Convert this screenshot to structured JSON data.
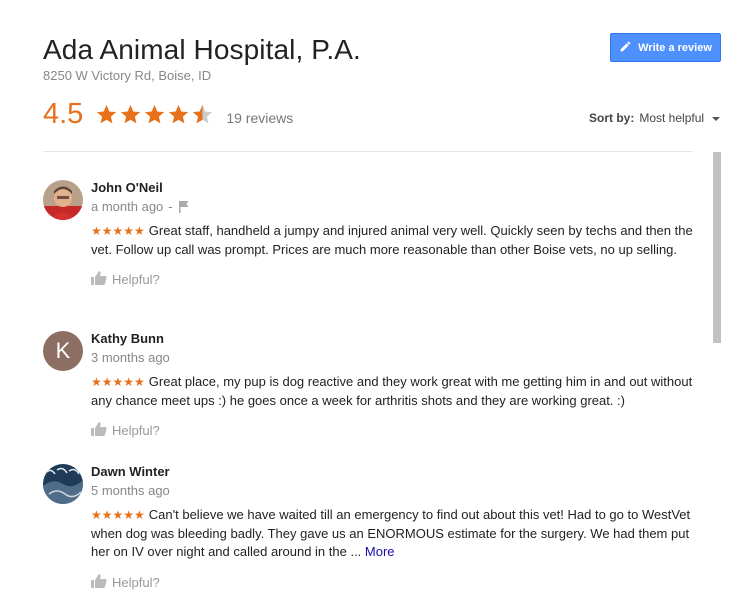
{
  "business": {
    "name": "Ada Animal Hospital, P.A.",
    "address": "8250 W Victory Rd, Boise, ID",
    "rating": "4.5",
    "rating_value": 4.5,
    "review_count_label": "19 reviews",
    "write_review_label": "Write a review"
  },
  "sort": {
    "label": "Sort by:",
    "value": "Most helpful"
  },
  "colors": {
    "star": "#e7711b",
    "button": "#4d90fe",
    "link": "#1a0dab"
  },
  "reviews": [
    {
      "author": "John O'Neil",
      "time": "a month ago",
      "separator": "-",
      "stars": "★★★★★",
      "text": "Great staff, handheld a jumpy and injured animal very well. Quickly seen by techs and then the vet. Follow up call was prompt. Prices are much more reasonable than other Boise vets, no up selling.",
      "helpful": "Helpful?"
    },
    {
      "author": "Kathy Bunn",
      "avatar_letter": "K",
      "time": "3 months ago",
      "stars": "★★★★★",
      "text": "Great place, my pup is dog reactive and they work great with me getting him in and out without any chance meet ups :) he goes once a week for arthritis shots and they are working great. :)",
      "helpful": "Helpful?"
    },
    {
      "author": "Dawn Winter",
      "time": "5 months ago",
      "stars": "★★★★★",
      "text": "Can't believe we have waited till an emergency to find out about this vet!  Had to go to WestVet when dog was bleeding badly.  They gave us an ENORMOUS estimate for the surgery.  We had them put her on IV over night and called around in the ...",
      "more": "More",
      "helpful": "Helpful?"
    }
  ]
}
